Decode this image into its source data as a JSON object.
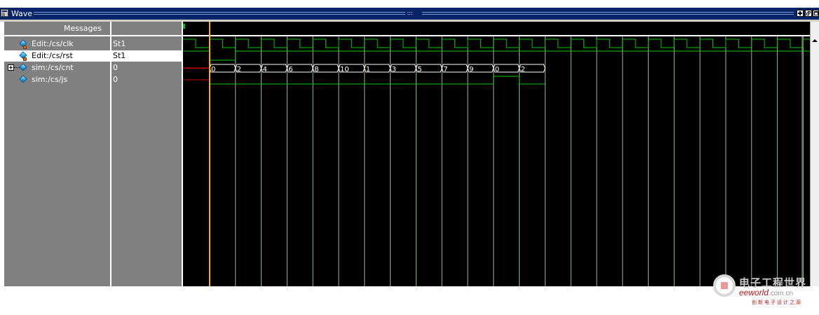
{
  "window": {
    "title": "Wave",
    "colors": {
      "titlebar": "#0a246a",
      "pane": "#808080",
      "wave_bg": "#000000",
      "wave": "#00c800",
      "grid": "#8fbf8f",
      "cursor": "#ffb000",
      "marker": "#cc0000"
    }
  },
  "panes": {
    "messages_header": "Messages"
  },
  "signals": [
    {
      "name": "Edit:/cs/clk",
      "value": "St1",
      "icon": "locked-signal-icon",
      "kind": "clock",
      "selected": false
    },
    {
      "name": "Edit:/cs/rst",
      "value": "St1",
      "icon": "locked-signal-icon",
      "kind": "reset",
      "selected": true
    },
    {
      "name": "sim:/cs/cnt",
      "value": "0",
      "icon": "signal-icon",
      "kind": "bus",
      "expandable": true,
      "selected": false
    },
    {
      "name": "sim:/cs/js",
      "value": "0",
      "icon": "signal-icon",
      "kind": "logic",
      "selected": false
    }
  ],
  "cnt_bus": [
    "0",
    "2",
    "4",
    "6",
    "8",
    "10",
    "1",
    "3",
    "5",
    "7",
    "9",
    "0",
    "2"
  ],
  "watermark": {
    "cn": "电子工程世界",
    "url_main": "eeworld",
    "url_suffix": ".com.cn",
    "slogan": "创新电子设计之源"
  }
}
